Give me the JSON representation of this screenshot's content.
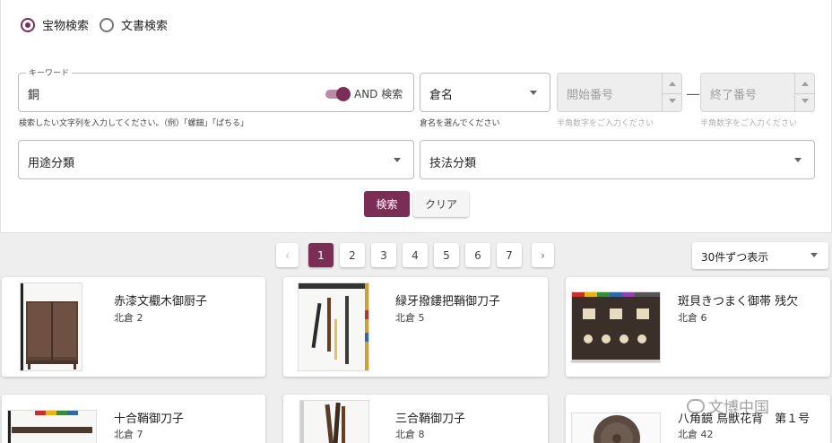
{
  "search_mode": {
    "options": [
      "宝物検索",
      "文書検索"
    ],
    "selected": "宝物検索"
  },
  "keyword": {
    "legend": "キーワード",
    "value": "銅",
    "toggle_label": "AND 検索",
    "helper": "検索したい文字列を入力してください。（例）「螺鈿」「ぱちる」"
  },
  "storehouse": {
    "placeholder": "倉名",
    "helper": "倉名を選んでください"
  },
  "start_no": {
    "placeholder": "開始番号",
    "helper": "半角数字をご入力ください"
  },
  "end_no": {
    "placeholder": "終了番号",
    "helper": "半角数字をご入力ください"
  },
  "range_sep": "—",
  "usage": {
    "placeholder": "用途分類"
  },
  "technique": {
    "placeholder": "技法分類"
  },
  "buttons": {
    "search": "検索",
    "clear": "クリア"
  },
  "pagination": {
    "prev": "‹",
    "next": "›",
    "pages": [
      "1",
      "2",
      "3",
      "4",
      "5",
      "6",
      "7"
    ],
    "current": "1"
  },
  "per_page": "30件ずつ表示",
  "results": [
    {
      "title": "赤漆文欟木御厨子",
      "location": "北倉 2"
    },
    {
      "title": "緑牙撥鏤把鞘御刀子",
      "location": "北倉 5"
    },
    {
      "title": "斑貝きつまく御帯 残欠",
      "location": "北倉 6"
    },
    {
      "title": "十合鞘御刀子",
      "location": "北倉 7"
    },
    {
      "title": "三合鞘御刀子",
      "location": "北倉 8"
    },
    {
      "title": "八角鏡 鳥獣花背　第１号",
      "location": "北倉 42"
    }
  ],
  "watermark": "文博中国",
  "colors": {
    "accent": "#7b2d55",
    "page_bg": "#eeeeee"
  }
}
